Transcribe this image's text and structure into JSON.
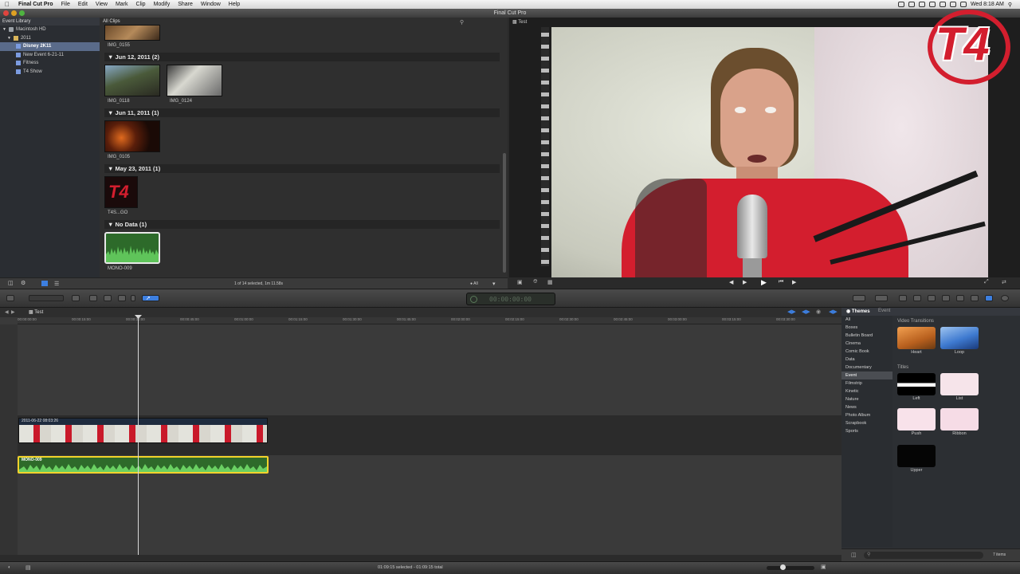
{
  "menubar": {
    "items": [
      "Final Cut Pro",
      "File",
      "Edit",
      "View",
      "Mark",
      "Clip",
      "Modify",
      "Share",
      "Window",
      "Help"
    ],
    "clock": "Wed 8:18 AM"
  },
  "window": {
    "title": "Final Cut Pro"
  },
  "library": {
    "header": "Event Library",
    "items": [
      {
        "label": "Macintosh HD",
        "level": 0,
        "selected": false
      },
      {
        "label": "2011",
        "level": 1,
        "selected": false
      },
      {
        "label": "Disney 2K11",
        "level": 2,
        "selected": true
      },
      {
        "label": "New Event 6-21-11",
        "level": 2,
        "selected": false
      },
      {
        "label": "Fitness",
        "level": 2,
        "selected": false
      },
      {
        "label": "T4 Show",
        "level": 2,
        "selected": false
      }
    ]
  },
  "browser": {
    "header": "All Clips",
    "groups": [
      {
        "label": "Jun 12, 2011  (2)"
      },
      {
        "label": "Jun 11, 2011  (1)"
      },
      {
        "label": "May 23, 2011  (1)"
      },
      {
        "label": "No Data  (1)"
      }
    ],
    "clips": [
      {
        "label": "IMG_0155"
      },
      {
        "label": "IMG_0118"
      },
      {
        "label": "IMG_0124"
      },
      {
        "label": "IMG_0105"
      },
      {
        "label": "T4S...GO"
      },
      {
        "label": "MONO-009"
      }
    ],
    "status": "1 of 14 selected, 1m 11.58s",
    "filter": "All"
  },
  "viewer": {
    "tab": "Test"
  },
  "timeline": {
    "project_tab": "Test",
    "ruler": [
      "00:00:00:00",
      "00:00:15:00",
      "00:00:30:00",
      "00:00:45:00",
      "00:01:00:00",
      "00:01:15:00",
      "00:01:30:00",
      "00:01:45:00",
      "00:02:00:00",
      "00:02:15:00",
      "00:02:30:00",
      "00:02:45:00",
      "00:03:00:00",
      "00:03:15:00",
      "00:03:30:00"
    ],
    "video_clip": "2011-06-22 08:03:26",
    "audio_clip": "MONO-009",
    "status": "01:09:15 selected - 01:09:15 total",
    "timecode": "00:00:00:00"
  },
  "effects": {
    "tabs": [
      "Themes",
      "Event"
    ],
    "categories": [
      "All",
      "Boxes",
      "Bulletin Board",
      "Cinema",
      "Comic Book",
      "Data",
      "Documentary",
      "Event",
      "Filmstrip",
      "Kinetic",
      "Nature",
      "News",
      "Photo Album",
      "Scrapbook",
      "Sports"
    ],
    "selected_category": "Event",
    "section_transitions": "Video Transitions",
    "section_titles": "Titles",
    "transitions": [
      {
        "label": "Heart"
      },
      {
        "label": "Loop"
      }
    ],
    "titles": [
      {
        "label": "Left"
      },
      {
        "label": "List"
      },
      {
        "label": "Push"
      },
      {
        "label": "Ribbon"
      },
      {
        "label": "Upper"
      }
    ],
    "count": "7 items"
  },
  "logo": {
    "text": "T4"
  },
  "colors": {
    "accent": "#3d7fe0",
    "selection_yellow": "#f2d22b",
    "audio_green": "#3e8a3a",
    "shirt_red": "#d31e2e"
  }
}
